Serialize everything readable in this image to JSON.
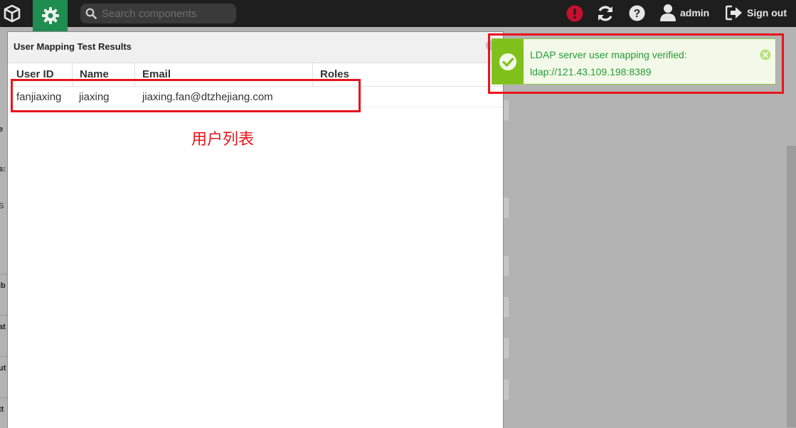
{
  "topbar": {
    "search_placeholder": "Search components",
    "user_label": "admin",
    "signout_label": "Sign out"
  },
  "dialog": {
    "title": "User Mapping Test Results",
    "columns": [
      "User ID",
      "Name",
      "Email",
      "Roles"
    ],
    "rows": [
      {
        "user_id": "fanjiaxing",
        "name": "jiaxing",
        "email": "jiaxing.fan@dtzhejiang.com",
        "roles": ""
      }
    ]
  },
  "annotation": {
    "text": "用户列表"
  },
  "toast": {
    "line1": "LDAP server user mapping verified:",
    "line2": "ldap://121.43.109.198:8389"
  },
  "colors": {
    "topbar": "#1e1e1e",
    "active_tab": "#1f8d4f",
    "alert": "#c8102e",
    "toast_accent": "#80c01a",
    "toast_text": "#279a39",
    "annotation": "#e8141c"
  },
  "icons": [
    "cube-logo-icon",
    "gear-icon",
    "search-icon",
    "alert-icon",
    "refresh-icon",
    "help-icon",
    "user-icon",
    "signout-icon",
    "check-icon",
    "close-icon"
  ]
}
